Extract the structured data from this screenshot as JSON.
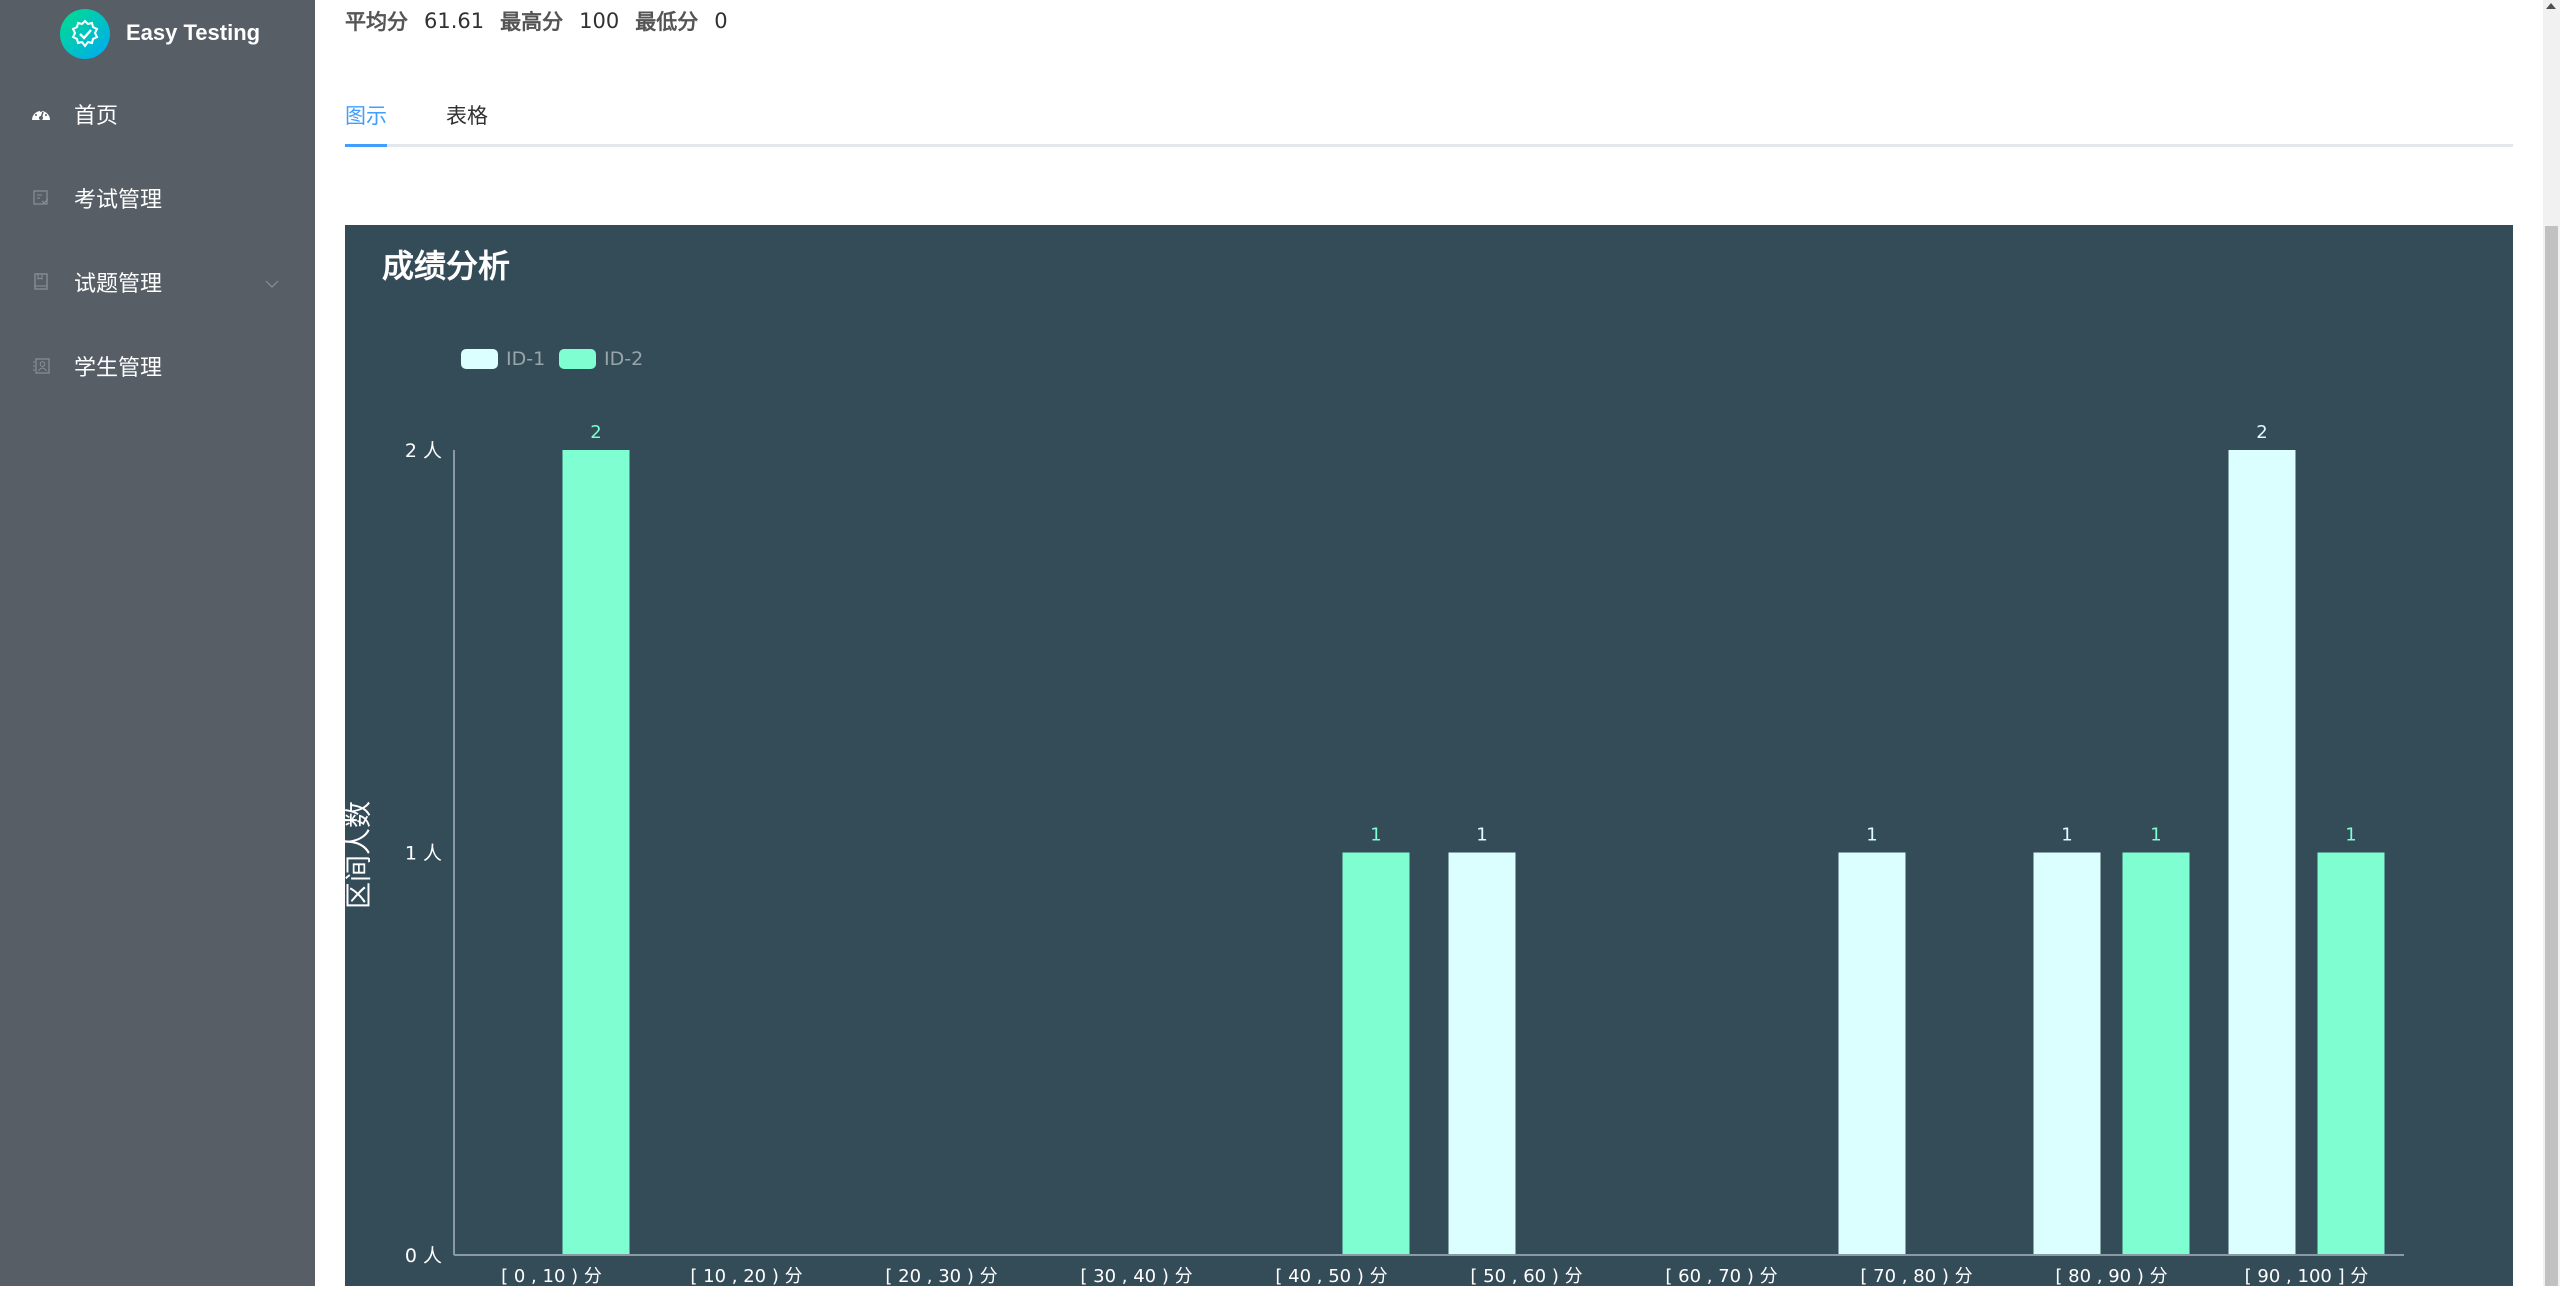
{
  "app": {
    "brand": "Easy Testing"
  },
  "sidebar": {
    "items": [
      {
        "label": "首页",
        "icon": "dashboard-icon"
      },
      {
        "label": "考试管理",
        "icon": "exam-list-icon"
      },
      {
        "label": "试题管理",
        "icon": "question-book-icon",
        "has_submenu": true
      },
      {
        "label": "学生管理",
        "icon": "student-contacts-icon"
      }
    ]
  },
  "stats": {
    "avg_label": "平均分",
    "avg_value": "61.61",
    "max_label": "最高分",
    "max_value": "100",
    "min_label": "最低分",
    "min_value": "0"
  },
  "tabs": [
    {
      "label": "图示",
      "active": true
    },
    {
      "label": "表格",
      "active": false
    }
  ],
  "colors": {
    "panel_bg": "#344b58",
    "id1": "#dbfefe",
    "id2": "#7ffed2",
    "accent": "#409eff"
  },
  "chart_data": {
    "type": "bar",
    "title": "成绩分析",
    "xlabel": "",
    "ylabel": "区间人数",
    "ylim": [
      0,
      2
    ],
    "yticks": [
      "0 人",
      "1 人",
      "2 人"
    ],
    "legend_position": "top-left",
    "categories": [
      "[ 0 , 10 ) 分",
      "[ 10 , 20 ) 分",
      "[ 20 , 30 ) 分",
      "[ 30 , 40 ) 分",
      "[ 40 , 50 ) 分",
      "[ 50 , 60 ) 分",
      "[ 60 , 70 ) 分",
      "[ 70 , 80 ) 分",
      "[ 80 , 90 ) 分",
      "[ 90 , 100 ] 分"
    ],
    "series": [
      {
        "name": "ID-1",
        "color": "#dbfefe",
        "values": [
          0,
          0,
          0,
          0,
          0,
          1,
          0,
          1,
          1,
          2
        ]
      },
      {
        "name": "ID-2",
        "color": "#7ffed2",
        "values": [
          2,
          0,
          0,
          0,
          1,
          0,
          0,
          0,
          1,
          1
        ]
      }
    ]
  }
}
